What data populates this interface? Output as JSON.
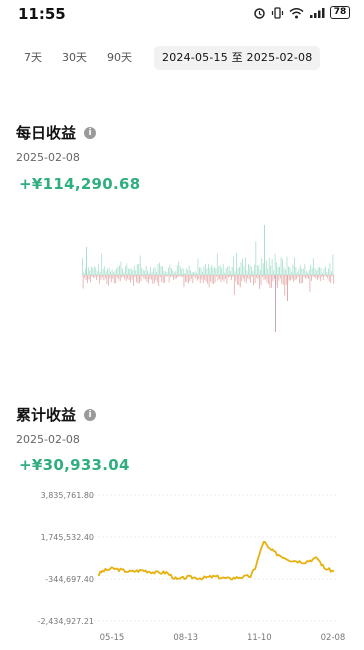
{
  "status_bar": {
    "time": "11:55",
    "battery": "78"
  },
  "range_tabs": [
    {
      "label": "7天"
    },
    {
      "label": "30天"
    },
    {
      "label": "90天"
    }
  ],
  "date_range": "2024-05-15 至 2025-02-08",
  "daily": {
    "title": "每日收益",
    "date": "2025-02-08",
    "value": "+¥114,290.68"
  },
  "cumulative": {
    "title": "累计收益",
    "date": "2025-02-08",
    "value": "+¥30,933.04"
  },
  "colors": {
    "positive": "#2fae7f",
    "gain_bar": "#a6dfcb",
    "loss_bar": "#e5a9a9",
    "line": "#e6b10f"
  },
  "chart_data": [
    {
      "type": "bar",
      "title": "每日收益",
      "x": [
        "2024-05-15",
        "2025-02-08"
      ],
      "values": [
        {
          "x": "2024-05-15",
          "y": 8000
        },
        {
          "x": "2024-11-10",
          "y": 60000
        },
        {
          "x": "2024-11-12",
          "y": -45000
        },
        {
          "x": "2024-11-13",
          "y": -70000
        },
        {
          "x": "2025-02-08",
          "y": 114290.68
        }
      ],
      "note": "daily gain/loss bars, green positive, red negative"
    },
    {
      "type": "line",
      "title": "累计收益",
      "y_ticks": [
        "3,835,761.80",
        "1,745,532.40",
        "-344,697.40",
        "-2,434,927.21"
      ],
      "ylim": [
        -2434927.21,
        3835761.8
      ],
      "x_ticks": [
        "05-15",
        "08-13",
        "11-10",
        "02-08"
      ],
      "series": [
        {
          "values": [
            {
              "x": "05-15",
              "y": -150000
            },
            {
              "x": "05-20",
              "y": 50000
            },
            {
              "x": "06-01",
              "y": 180000
            },
            {
              "x": "06-20",
              "y": 20000
            },
            {
              "x": "07-05",
              "y": 90000
            },
            {
              "x": "07-20",
              "y": -30000
            },
            {
              "x": "08-01",
              "y": -20000
            },
            {
              "x": "08-13",
              "y": -380000
            },
            {
              "x": "08-25",
              "y": -250000
            },
            {
              "x": "09-10",
              "y": -300000
            },
            {
              "x": "09-25",
              "y": -220000
            },
            {
              "x": "10-10",
              "y": -330000
            },
            {
              "x": "10-25",
              "y": -250000
            },
            {
              "x": "11-05",
              "y": -200000
            },
            {
              "x": "11-10",
              "y": 200000
            },
            {
              "x": "11-20",
              "y": 1550000
            },
            {
              "x": "11-25",
              "y": 1200000
            },
            {
              "x": "12-05",
              "y": 900000
            },
            {
              "x": "12-20",
              "y": 600000
            },
            {
              "x": "01-05",
              "y": 500000
            },
            {
              "x": "01-20",
              "y": 700000
            },
            {
              "x": "01-28",
              "y": 200000
            },
            {
              "x": "02-08",
              "y": 30933.04
            }
          ]
        }
      ]
    }
  ]
}
